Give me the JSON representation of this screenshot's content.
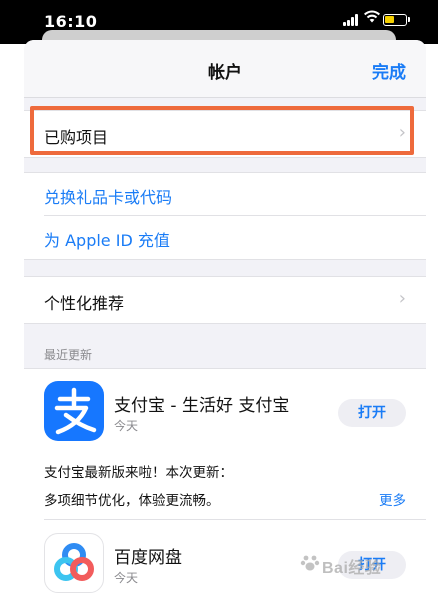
{
  "status_bar": {
    "time": "16:10"
  },
  "nav": {
    "title": "帐户",
    "done_label": "完成"
  },
  "account_rows": {
    "purchased": "已购项目",
    "redeem": "兑换礼品卡或代码",
    "add_funds": "为 Apple ID 充值",
    "personalized": "个性化推荐"
  },
  "updates": {
    "section_header": "最近更新",
    "apps": [
      {
        "name": "支付宝 - 生活好 支付宝",
        "date": "今天",
        "button_label": "打开",
        "icon": "alipay-icon",
        "notes_line1": "支付宝最新版来啦！本次更新：",
        "notes_line2": "多项细节优化，体验更流畅。",
        "more_label": "更多"
      },
      {
        "name": "百度网盘",
        "date": "今天",
        "button_label": "打开",
        "icon": "baidu-netdisk-icon"
      }
    ]
  },
  "watermark": {
    "text": "Bai经验"
  },
  "colors": {
    "accent": "#1a7cf6",
    "highlight": "#ee6a3c",
    "alipay": "#1677ff"
  }
}
